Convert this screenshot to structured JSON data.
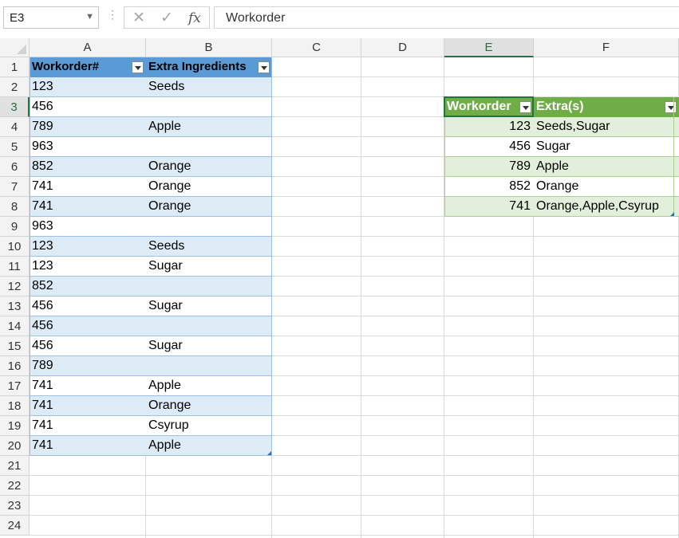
{
  "formula_bar": {
    "name_box": "E3",
    "formula": "Workorder"
  },
  "columns": [
    "A",
    "B",
    "C",
    "D",
    "E",
    "F"
  ],
  "rows": [
    "1",
    "2",
    "3",
    "4",
    "5",
    "6",
    "7",
    "8",
    "9",
    "10",
    "11",
    "12",
    "13",
    "14",
    "15",
    "16",
    "17",
    "18",
    "19",
    "20",
    "21",
    "22",
    "23",
    "24"
  ],
  "table1": {
    "headers": [
      "Workorder#",
      "Extra Ingredients"
    ],
    "rows": [
      [
        "123",
        "Seeds"
      ],
      [
        "456",
        ""
      ],
      [
        "789",
        "Apple"
      ],
      [
        "963",
        ""
      ],
      [
        "852",
        "Orange"
      ],
      [
        "741",
        "Orange"
      ],
      [
        "741",
        "Orange"
      ],
      [
        "963",
        ""
      ],
      [
        "123",
        "Seeds"
      ],
      [
        "123",
        "Sugar"
      ],
      [
        "852",
        ""
      ],
      [
        "456",
        "Sugar"
      ],
      [
        "456",
        ""
      ],
      [
        "456",
        "Sugar"
      ],
      [
        "789",
        ""
      ],
      [
        "741",
        "Apple"
      ],
      [
        "741",
        "Orange"
      ],
      [
        "741",
        "Csyrup"
      ],
      [
        "741",
        "Apple"
      ]
    ]
  },
  "table2": {
    "headers": [
      "Workorder",
      "Extra(s)"
    ],
    "rows": [
      [
        "123",
        "Seeds,Sugar"
      ],
      [
        "456",
        "Sugar"
      ],
      [
        "789",
        "Apple"
      ],
      [
        "852",
        "Orange"
      ],
      [
        "741",
        "Orange,Apple,Csyrup"
      ]
    ]
  },
  "selection": {
    "cell": "E3",
    "column": "E",
    "row": "3"
  },
  "colors": {
    "table1_header": "#5b9bd5",
    "table1_band": "#ddebf7",
    "table2_header": "#70ad47",
    "table2_band": "#e2efda",
    "selection": "#217346"
  }
}
